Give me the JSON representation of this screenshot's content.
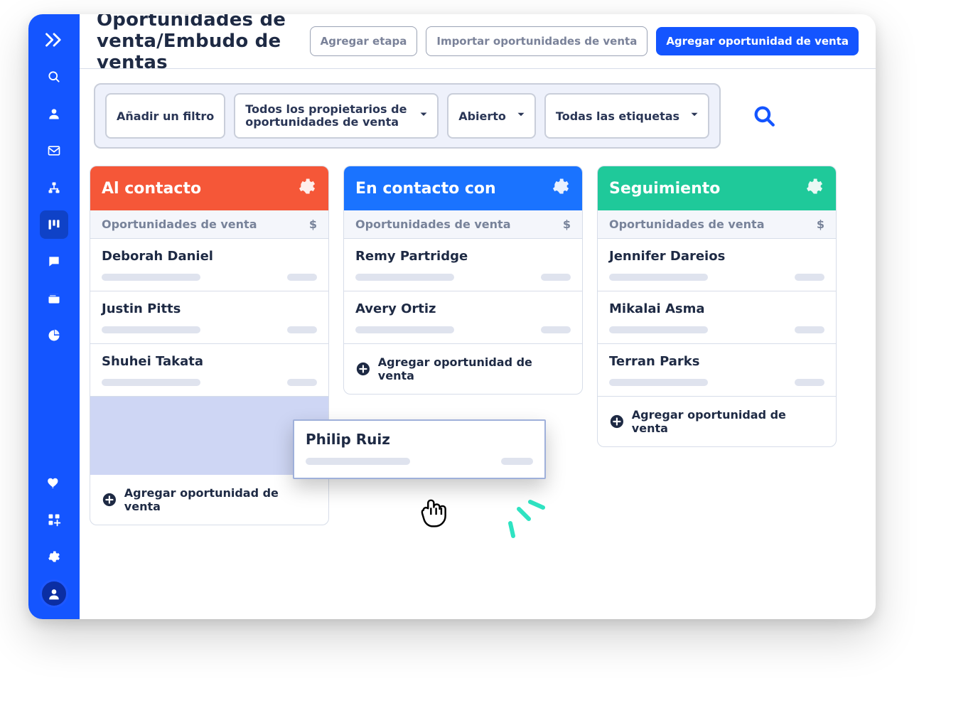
{
  "header": {
    "title": "Oportunidades de venta/Embudo de ventas",
    "buttons": {
      "add_stage": "Agregar etapa",
      "import": "Importar oportunidades de venta",
      "add_deal": "Agregar oportunidad de venta"
    }
  },
  "filters": {
    "add_filter": "Añadir un filtro",
    "owners_line1": "Todos los propietarios de",
    "owners_line2": "oportunidades de venta",
    "status": "Abierto",
    "tags": "Todas las etiquetas"
  },
  "columns": [
    {
      "title": "Al contacto",
      "color": "orange",
      "sub_label": "Oportunidades de venta",
      "sub_currency": "$",
      "cards": [
        {
          "name": "Deborah Daniel"
        },
        {
          "name": "Justin Pitts"
        },
        {
          "name": "Shuhei Takata"
        }
      ],
      "dragging_card": {
        "name": "Philip Ruiz"
      },
      "add_label": "Agregar oportunidad de venta"
    },
    {
      "title": "En contacto con",
      "color": "blue",
      "sub_label": "Oportunidades de venta",
      "sub_currency": "$",
      "cards": [
        {
          "name": "Remy Partridge"
        },
        {
          "name": "Avery Ortiz"
        }
      ],
      "add_label": "Agregar oportunidad de venta"
    },
    {
      "title": "Seguimiento",
      "color": "green",
      "sub_label": "Oportunidades de venta",
      "sub_currency": "$",
      "cards": [
        {
          "name": "Jennifer Dareios"
        },
        {
          "name": "Mikalai Asma"
        },
        {
          "name": "Terran Parks"
        }
      ],
      "add_label": "Agregar oportunidad de venta"
    }
  ]
}
